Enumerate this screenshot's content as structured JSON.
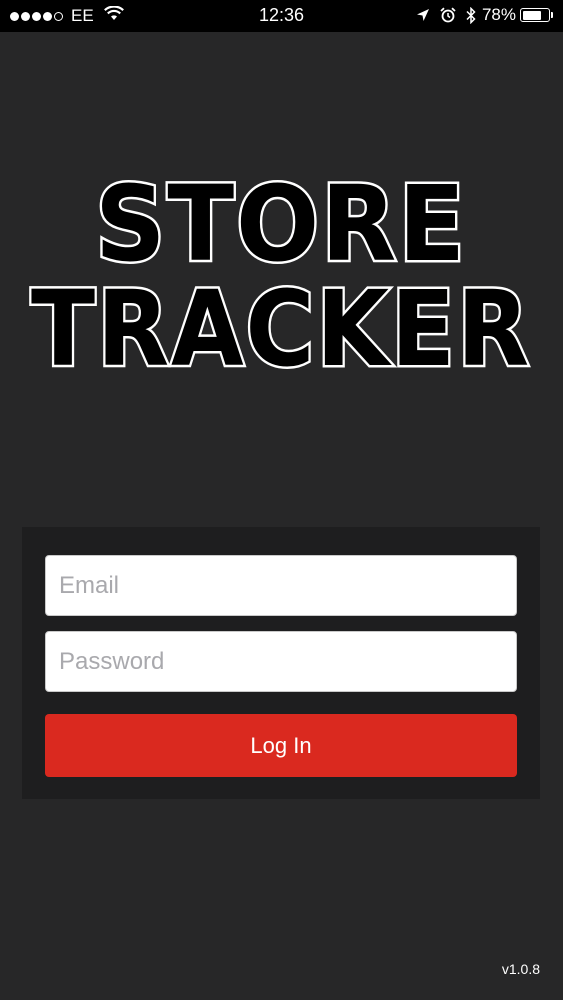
{
  "status_bar": {
    "carrier": "EE",
    "time": "12:36",
    "battery_percent": "78%",
    "battery_level": 0.78,
    "signal_bars_filled": 4,
    "signal_bars_total": 5,
    "icons": [
      "wifi-icon",
      "location-arrow-icon",
      "alarm-icon",
      "bluetooth-icon",
      "battery-icon"
    ]
  },
  "logo": {
    "line1": "STORE",
    "line2": "TRACKER"
  },
  "login": {
    "email_placeholder": "Email",
    "email_value": "",
    "password_placeholder": "Password",
    "password_value": "",
    "login_label": "Log In"
  },
  "footer": {
    "version": "v1.0.8"
  },
  "colors": {
    "background": "#272728",
    "panel": "#1e1e1f",
    "accent": "#da291f",
    "status_bar": "#000000"
  }
}
